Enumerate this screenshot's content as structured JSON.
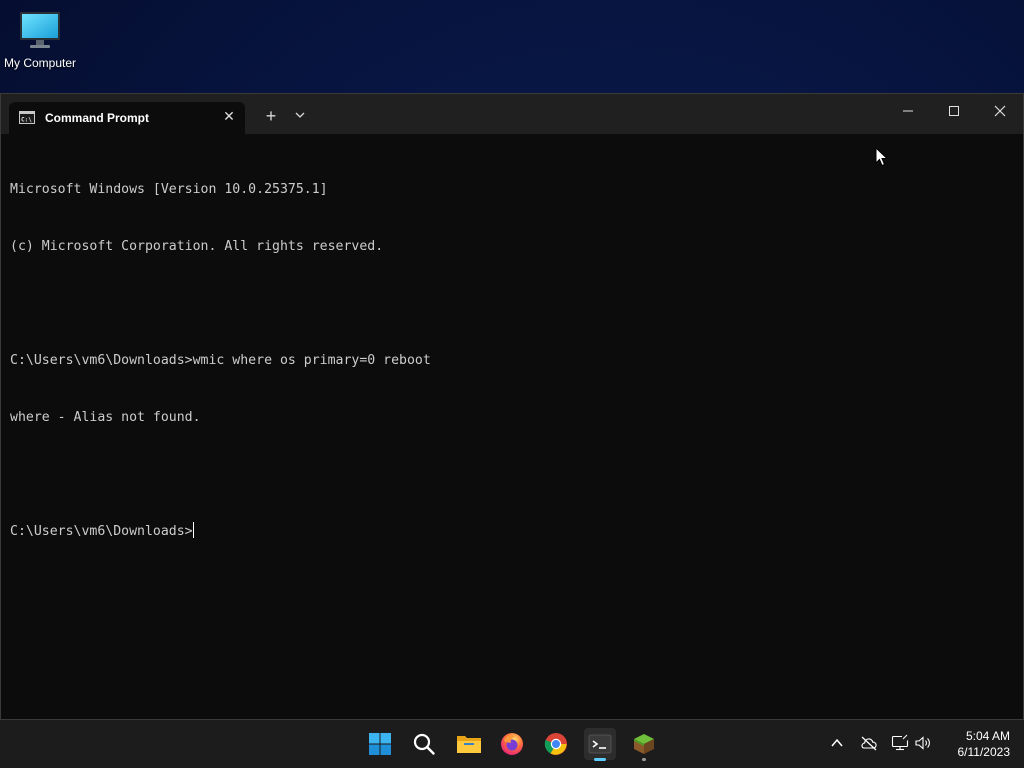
{
  "desktop": {
    "icons": [
      {
        "label": "My Computer",
        "icon": "monitor-icon"
      }
    ]
  },
  "window": {
    "tab_title": "Command Prompt",
    "tab_icon": "cmd-icon",
    "controls": {
      "new_tab": "+",
      "close_tab": "✕"
    },
    "console_lines": [
      "Microsoft Windows [Version 10.0.25375.1]",
      "(c) Microsoft Corporation. All rights reserved.",
      "",
      "C:\\Users\\vm6\\Downloads>wmic where os primary=0 reboot",
      "where - Alias not found.",
      "",
      "C:\\Users\\vm6\\Downloads>"
    ]
  },
  "taskbar": {
    "apps": [
      {
        "name": "start-button",
        "icon": "windows-logo-icon"
      },
      {
        "name": "search-button",
        "icon": "search-icon"
      },
      {
        "name": "file-explorer",
        "icon": "folder-icon"
      },
      {
        "name": "firefox",
        "icon": "firefox-icon"
      },
      {
        "name": "chrome",
        "icon": "chrome-icon"
      },
      {
        "name": "terminal",
        "icon": "terminal-icon",
        "active": true
      },
      {
        "name": "minecraft",
        "icon": "grass-block-icon"
      }
    ],
    "tray": [
      "chevron-up-icon",
      "cloud-off-icon",
      "network-icon",
      "volume-icon"
    ],
    "clock": {
      "time": "5:04 AM",
      "date": "6/11/2023"
    }
  },
  "colors": {
    "terminal_bg": "#0c0c0c",
    "titlebar_bg": "#202020",
    "terminal_text": "#cccccc",
    "taskbar_bg": "#1c1c1c",
    "accent": "#60cdff"
  }
}
